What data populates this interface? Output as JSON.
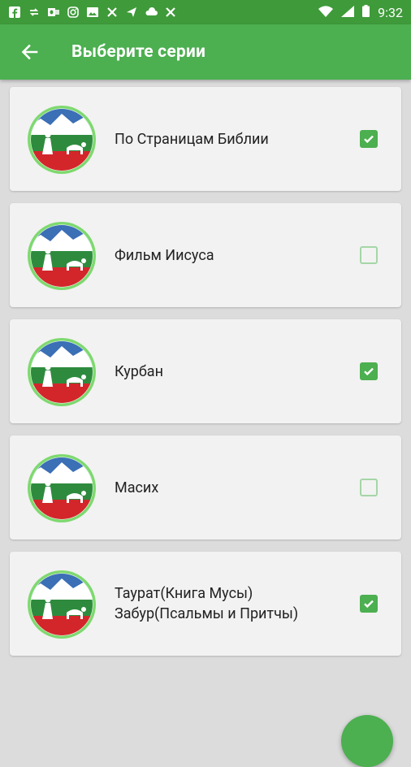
{
  "status_bar": {
    "time": "9:32",
    "icons_left": [
      "facebook-icon",
      "sync-icon",
      "outlook-icon",
      "instagram-icon",
      "image-icon",
      "crossed-tools-icon",
      "send-icon",
      "cloud-icon",
      "crossed-tools-icon"
    ],
    "icons_right": [
      "wifi-icon",
      "signal-icon",
      "battery-icon"
    ]
  },
  "app_bar": {
    "title": "Выберите серии",
    "back_icon": "arrow-back-icon"
  },
  "colors": {
    "primary": "#4caf50",
    "status_bar": "#3f9a3a",
    "card": "#f2f2f2",
    "background": "#dcdcdc"
  },
  "series": [
    {
      "label": "По Страницам Библии",
      "checked": true
    },
    {
      "label": "Фильм Иисуса",
      "checked": false
    },
    {
      "label": "Курбан",
      "checked": true
    },
    {
      "label": "Масих",
      "checked": false
    },
    {
      "label": "Таурат(Книга Мусы)\nЗабур(Псальмы и Притчы)",
      "checked": true
    }
  ]
}
